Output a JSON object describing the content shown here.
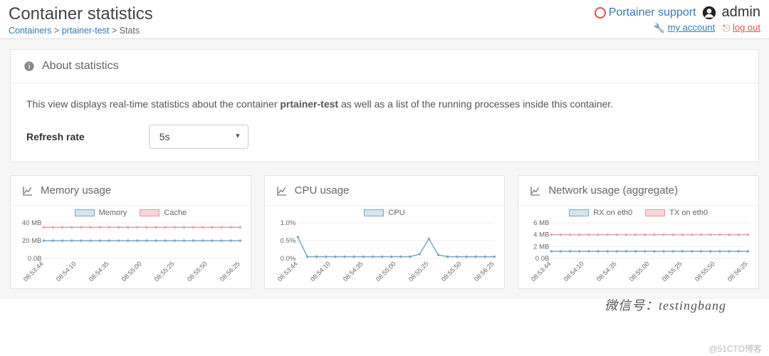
{
  "header": {
    "title": "Container statistics",
    "breadcrumb": {
      "containers": "Containers",
      "container_name": "prtainer-test",
      "current": "Stats"
    },
    "support_label": "Portainer support",
    "username": "admin",
    "my_account": "my account",
    "log_out": "log out"
  },
  "about": {
    "heading": "About statistics",
    "desc_pre": "This view displays real-time statistics about the container ",
    "desc_bold": "prtainer-test",
    "desc_post": " as well as a list of the running processes inside this container.",
    "refresh_label": "Refresh rate",
    "refresh_value": "5s"
  },
  "charts": {
    "memory": {
      "title": "Memory usage",
      "legend_a": "Memory",
      "legend_b": "Cache"
    },
    "cpu": {
      "title": "CPU usage",
      "legend_a": "CPU"
    },
    "network": {
      "title": "Network usage (aggregate)",
      "legend_a": "RX on eth0",
      "legend_b": "TX on eth0"
    }
  },
  "watermark": "微信号：testingbang",
  "attribution": "@51CTO博客",
  "chart_data": [
    {
      "type": "line",
      "title": "Memory usage",
      "xlabel": "",
      "ylabel": "",
      "x": [
        "08:53:44",
        "08:54:10",
        "08:54:35",
        "08:55:00",
        "08:55:25",
        "08:55:50",
        "08:56:25"
      ],
      "ylim": [
        0,
        40
      ],
      "yunit": "MB",
      "yticks": [
        "0.0B",
        "20 MB",
        "40 MB"
      ],
      "series": [
        {
          "name": "Memory",
          "color": "#7aa8c4",
          "values": [
            20,
            20,
            20,
            20,
            20,
            20,
            20,
            20,
            20,
            20,
            20,
            20,
            20,
            20,
            20,
            20,
            20,
            20,
            20,
            20,
            20,
            20
          ]
        },
        {
          "name": "Cache",
          "color": "#e6a0a7",
          "values": [
            35,
            35,
            35,
            35,
            35,
            35,
            35,
            35,
            35,
            35,
            35,
            35,
            35,
            35,
            35,
            35,
            35,
            35,
            35,
            35,
            35,
            35
          ]
        }
      ]
    },
    {
      "type": "line",
      "title": "CPU usage",
      "xlabel": "",
      "ylabel": "",
      "x": [
        "08:53:44",
        "08:54:10",
        "08:54:35",
        "08:55:00",
        "08:55:25",
        "08:55:50",
        "08:56:25"
      ],
      "ylim": [
        0,
        1.0
      ],
      "yunit": "%",
      "yticks": [
        "0.0%",
        "0.5%",
        "1.0%"
      ],
      "series": [
        {
          "name": "CPU",
          "color": "#7aa8c4",
          "values": [
            0.6,
            0.05,
            0.05,
            0.05,
            0.05,
            0.05,
            0.05,
            0.05,
            0.05,
            0.05,
            0.05,
            0.05,
            0.05,
            0.12,
            0.55,
            0.1,
            0.05,
            0.05,
            0.05,
            0.05,
            0.05,
            0.05
          ]
        }
      ]
    },
    {
      "type": "line",
      "title": "Network usage (aggregate)",
      "xlabel": "",
      "ylabel": "",
      "x": [
        "08:53:44",
        "08:54:10",
        "08:54:35",
        "08:55:00",
        "08:55:25",
        "08:55:50",
        "08:56:25"
      ],
      "ylim": [
        0,
        6
      ],
      "yunit": "MB",
      "yticks": [
        "0.0B",
        "2 MB",
        "4 MB",
        "6 MB"
      ],
      "series": [
        {
          "name": "RX on eth0",
          "color": "#7aa8c4",
          "values": [
            1.2,
            1.2,
            1.2,
            1.2,
            1.2,
            1.2,
            1.2,
            1.2,
            1.2,
            1.2,
            1.2,
            1.2,
            1.2,
            1.2,
            1.2,
            1.2,
            1.2,
            1.2,
            1.2,
            1.2,
            1.2,
            1.2
          ]
        },
        {
          "name": "TX on eth0",
          "color": "#e6a0a7",
          "values": [
            4.0,
            4.0,
            4.0,
            4.0,
            4.0,
            4.0,
            4.0,
            4.0,
            4.0,
            4.0,
            4.0,
            4.0,
            4.0,
            4.0,
            4.0,
            4.0,
            4.0,
            4.0,
            4.0,
            4.0,
            4.0,
            4.0
          ]
        }
      ]
    }
  ]
}
